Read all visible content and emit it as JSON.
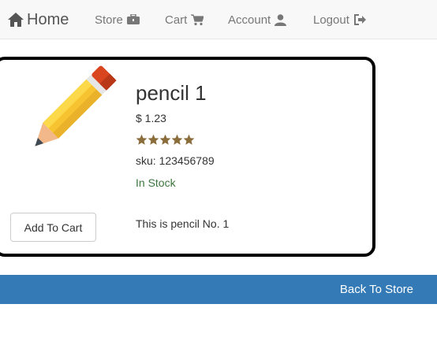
{
  "nav": {
    "home": "Home",
    "store": "Store",
    "cart": "Cart",
    "account": "Account",
    "logout": "Logout"
  },
  "product": {
    "name": "pencil 1",
    "price": "$ 1.23",
    "rating": 5,
    "rating_max": 5,
    "sku": "sku: 123456789",
    "stock": "In Stock",
    "description": "This is pencil No. 1",
    "add_to_cart": "Add To Cart"
  },
  "footer": {
    "back_to_store": "Back To Store"
  },
  "colors": {
    "navbar_bg": "#f8f8f8",
    "primary": "#337ab7",
    "stock_green": "#3c763d",
    "star": "#8a6d3b"
  }
}
